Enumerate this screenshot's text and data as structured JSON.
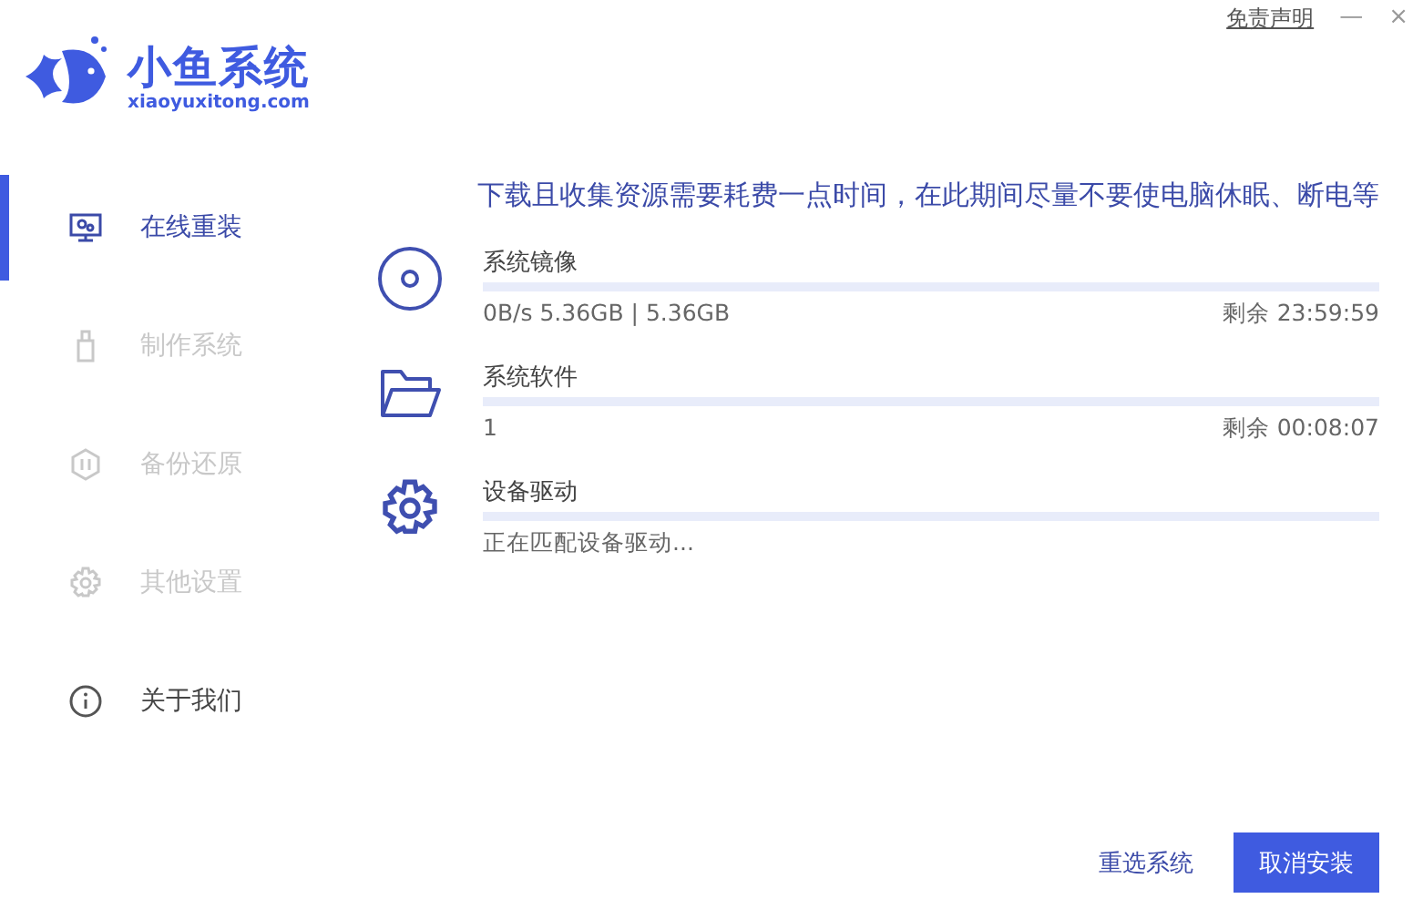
{
  "logo": {
    "name": "小鱼系统",
    "domain": "xiaoyuxitong.com"
  },
  "header": {
    "disclaimer": "免责声明",
    "minimize": "—",
    "close": "×"
  },
  "sidebar": {
    "items": [
      {
        "label": "在线重装",
        "kind": "monitor",
        "selected": true,
        "disabled": false
      },
      {
        "label": "制作系统",
        "kind": "usb",
        "selected": false,
        "disabled": true
      },
      {
        "label": "备份还原",
        "kind": "restore",
        "selected": false,
        "disabled": true
      },
      {
        "label": "其他设置",
        "kind": "gear",
        "selected": false,
        "disabled": true
      },
      {
        "label": "关于我们",
        "kind": "info",
        "selected": false,
        "disabled": false
      }
    ]
  },
  "notice": "下载且收集资源需要耗费一点时间，在此期间尽量不要使电脑休眠、断电等",
  "tasks": [
    {
      "kind": "disc",
      "title": "系统镜像",
      "detail": "0B/s 5.36GB | 5.36GB",
      "remaining": "剩余 23:59:59"
    },
    {
      "kind": "folder",
      "title": "系统软件",
      "detail": "1",
      "remaining": "剩余 00:08:07"
    },
    {
      "kind": "gear",
      "title": "设备驱动",
      "detail": "正在匹配设备驱动..."
    }
  ],
  "buttons": {
    "reselect": "重选系统",
    "cancel": "取消安装"
  }
}
